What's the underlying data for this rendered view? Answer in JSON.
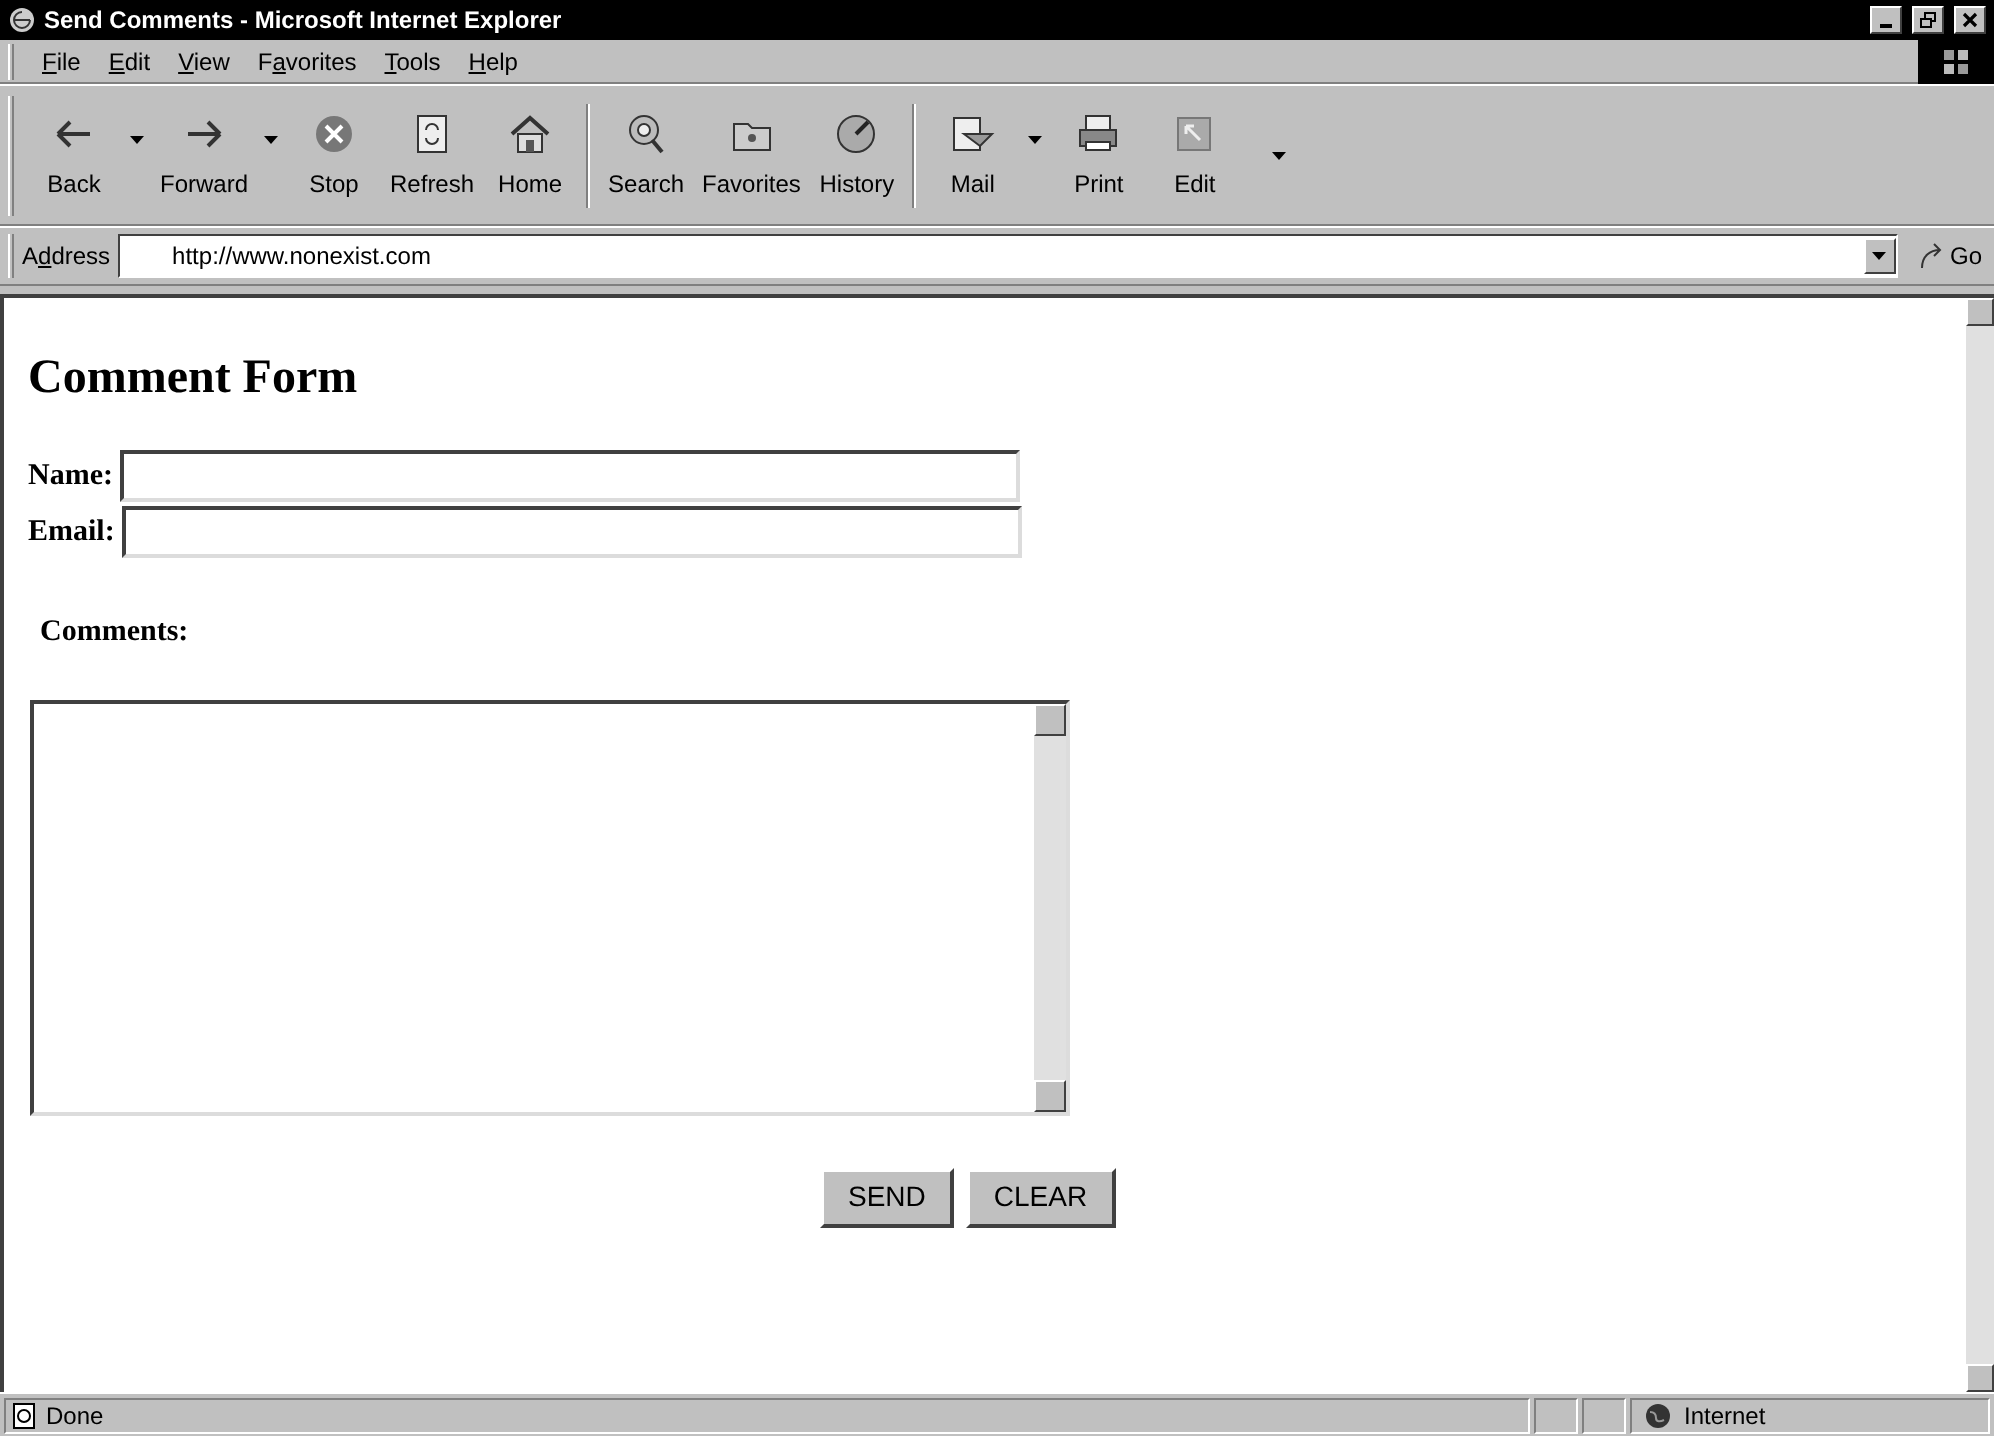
{
  "window": {
    "title": "Send Comments - Microsoft Internet Explorer"
  },
  "menu": [
    {
      "key": "F",
      "post": "ile"
    },
    {
      "key": "E",
      "post": "dit"
    },
    {
      "key": "V",
      "post": "iew"
    },
    {
      "pre": "F",
      "key": "a",
      "post": "vorites"
    },
    {
      "key": "T",
      "post": "ools"
    },
    {
      "key": "H",
      "post": "elp"
    }
  ],
  "toolbar": {
    "groups": [
      [
        {
          "label": "Back",
          "dropdown": true
        },
        {
          "label": "Forward",
          "dropdown": true
        },
        {
          "label": "Stop",
          "dropdown": false
        },
        {
          "label": "Refresh",
          "dropdown": false
        },
        {
          "label": "Home",
          "dropdown": false
        }
      ],
      [
        {
          "label": "Search",
          "dropdown": false
        },
        {
          "label": "Favorites",
          "dropdown": false
        },
        {
          "label": "History",
          "dropdown": false
        }
      ],
      [
        {
          "label": "Mail",
          "dropdown": true
        },
        {
          "label": "Print",
          "dropdown": false
        },
        {
          "label": "Edit",
          "dropdown": false
        }
      ]
    ],
    "more": true
  },
  "address": {
    "label": {
      "pre": "A",
      "key": "d",
      "post": "dress"
    },
    "value": "http://www.nonexist.com",
    "go": "Go"
  },
  "page": {
    "heading": "Comment Form",
    "fields": [
      {
        "label": "Name:"
      },
      {
        "label": "Email:"
      }
    ],
    "comments_label": "Comments:",
    "buttons": [
      "SEND",
      "CLEAR"
    ]
  },
  "status_bar": {
    "text": "Done",
    "zone": "Internet"
  }
}
